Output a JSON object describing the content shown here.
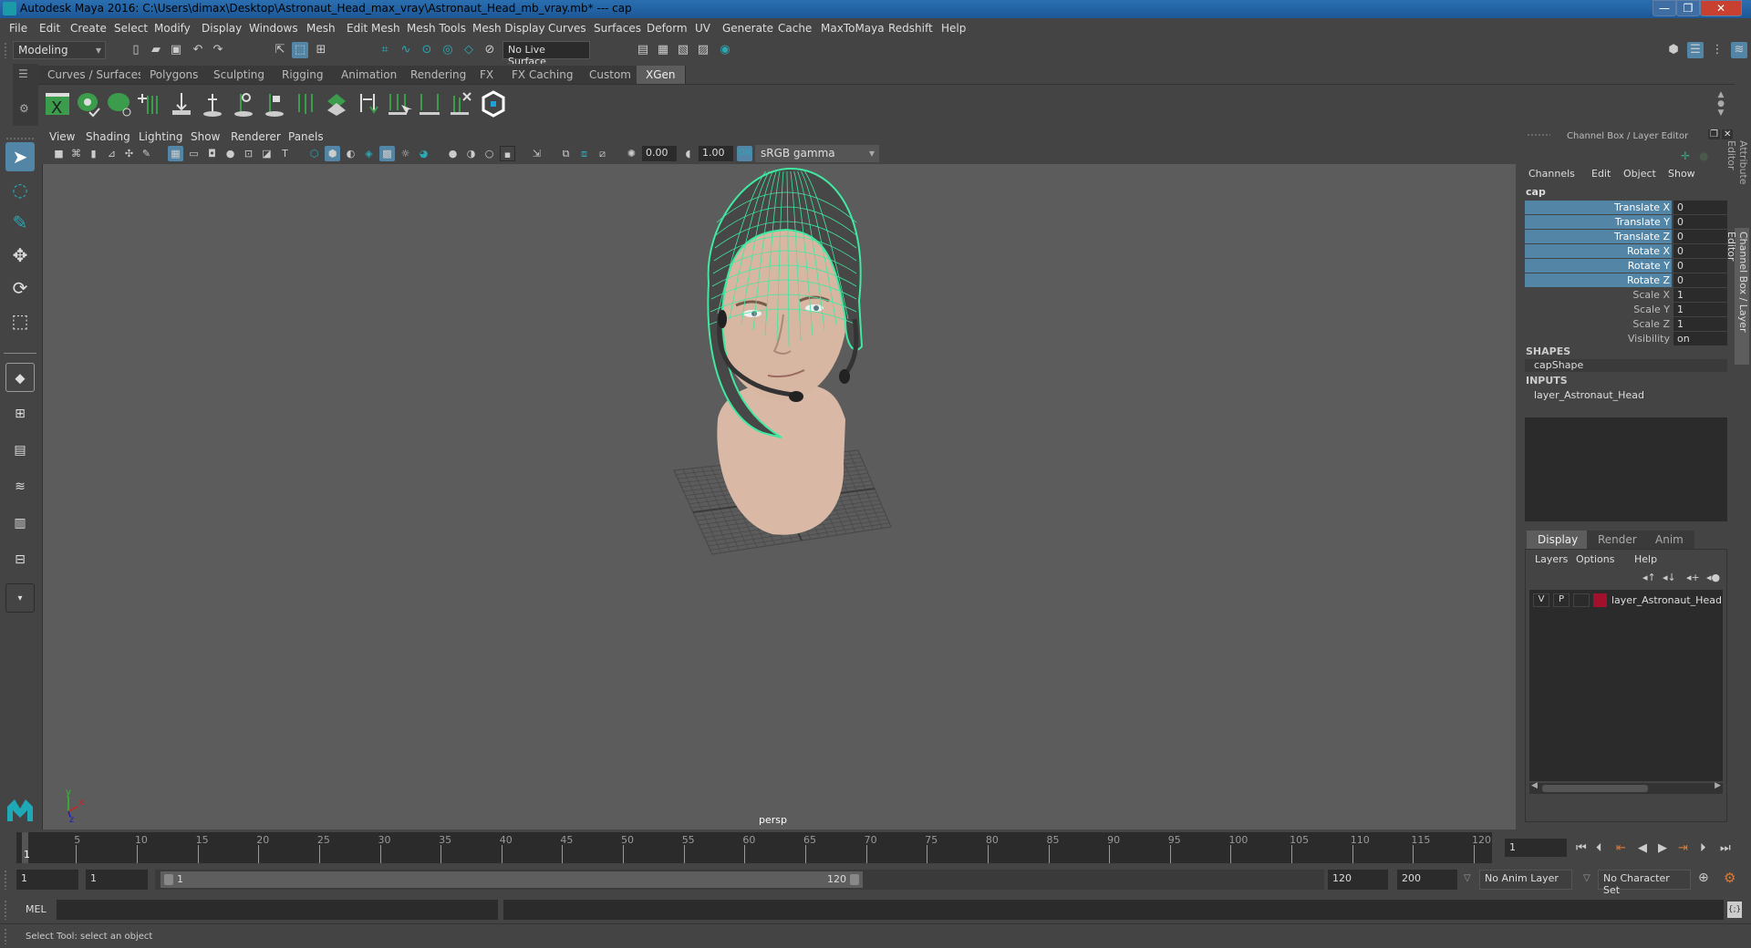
{
  "window": {
    "title": "Autodesk Maya 2016: C:\\Users\\dimax\\Desktop\\Astronaut_Head_max_vray\\Astronaut_Head_mb_vray.mb*   ---   cap",
    "minimize": "—",
    "restore": "❐",
    "close": "✕"
  },
  "menubar": [
    "File",
    "Edit",
    "Create",
    "Select",
    "Modify",
    "Display",
    "Windows",
    "Mesh",
    "Edit Mesh",
    "Mesh Tools",
    "Mesh Display",
    "Curves",
    "Surfaces",
    "Deform",
    "UV",
    "Generate",
    "Cache",
    "MaxToMaya",
    "Redshift",
    "Help"
  ],
  "statusline": {
    "mode": "Modeling",
    "live_surface": "No Live Surface"
  },
  "shelf": {
    "tabs": [
      "Curves / Surfaces",
      "Polygons",
      "Sculpting",
      "Rigging",
      "Animation",
      "Rendering",
      "FX",
      "FX Caching",
      "Custom",
      "XGen"
    ],
    "active_tab": "XGen"
  },
  "viewport": {
    "menu": [
      "View",
      "Shading",
      "Lighting",
      "Show",
      "Renderer",
      "Panels"
    ],
    "exposure": "0.00",
    "gamma": "1.00",
    "color_space": "sRGB gamma",
    "camera_label": "persp",
    "axis": {
      "x": "x",
      "y": "y",
      "z": "z"
    }
  },
  "channel_box": {
    "header": "Channel Box / Layer Editor",
    "menu": [
      "Channels",
      "Edit",
      "Object",
      "Show"
    ],
    "object": "cap",
    "channels": [
      {
        "label": "Translate X",
        "value": "0",
        "highlighted": true
      },
      {
        "label": "Translate Y",
        "value": "0",
        "highlighted": true
      },
      {
        "label": "Translate Z",
        "value": "0",
        "highlighted": true
      },
      {
        "label": "Rotate X",
        "value": "0",
        "highlighted": true
      },
      {
        "label": "Rotate Y",
        "value": "0",
        "highlighted": true
      },
      {
        "label": "Rotate Z",
        "value": "0",
        "highlighted": true
      },
      {
        "label": "Scale X",
        "value": "1",
        "highlighted": false
      },
      {
        "label": "Scale Y",
        "value": "1",
        "highlighted": false
      },
      {
        "label": "Scale Z",
        "value": "1",
        "highlighted": false
      },
      {
        "label": "Visibility",
        "value": "on",
        "highlighted": false
      }
    ],
    "shapes_header": "SHAPES",
    "shape": "capShape",
    "inputs_header": "INPUTS",
    "input": "layer_Astronaut_Head"
  },
  "layer_editor": {
    "tabs": [
      "Display",
      "Render",
      "Anim"
    ],
    "active_tab": "Display",
    "menu": [
      "Layers",
      "Options",
      "Help"
    ],
    "layers": [
      {
        "v": "V",
        "p": "P",
        "color": "#a3102c",
        "name": "layer_Astronaut_Head"
      }
    ]
  },
  "side_tabs": [
    "Attribute Editor",
    "Channel Box / Layer Editor"
  ],
  "timeline": {
    "ticks": [
      "5",
      "10",
      "15",
      "20",
      "25",
      "30",
      "35",
      "40",
      "45",
      "50",
      "55",
      "60",
      "65",
      "70",
      "75",
      "80",
      "85",
      "90",
      "95",
      "100",
      "105",
      "110",
      "115",
      "120"
    ],
    "current_frame_marker": "1",
    "current_frame_field": "1"
  },
  "range": {
    "start": "1",
    "playback_start": "1",
    "slider_start": "1",
    "slider_end": "120",
    "playback_end": "120",
    "end": "200",
    "anim_layer": "No Anim Layer",
    "character_set": "No Character Set"
  },
  "command_line": {
    "label": "MEL"
  },
  "help_line": "Select Tool: select an object",
  "colors": {
    "accent": "#5285a6",
    "wire": "#40e8a0",
    "layer": "#a3102c"
  }
}
